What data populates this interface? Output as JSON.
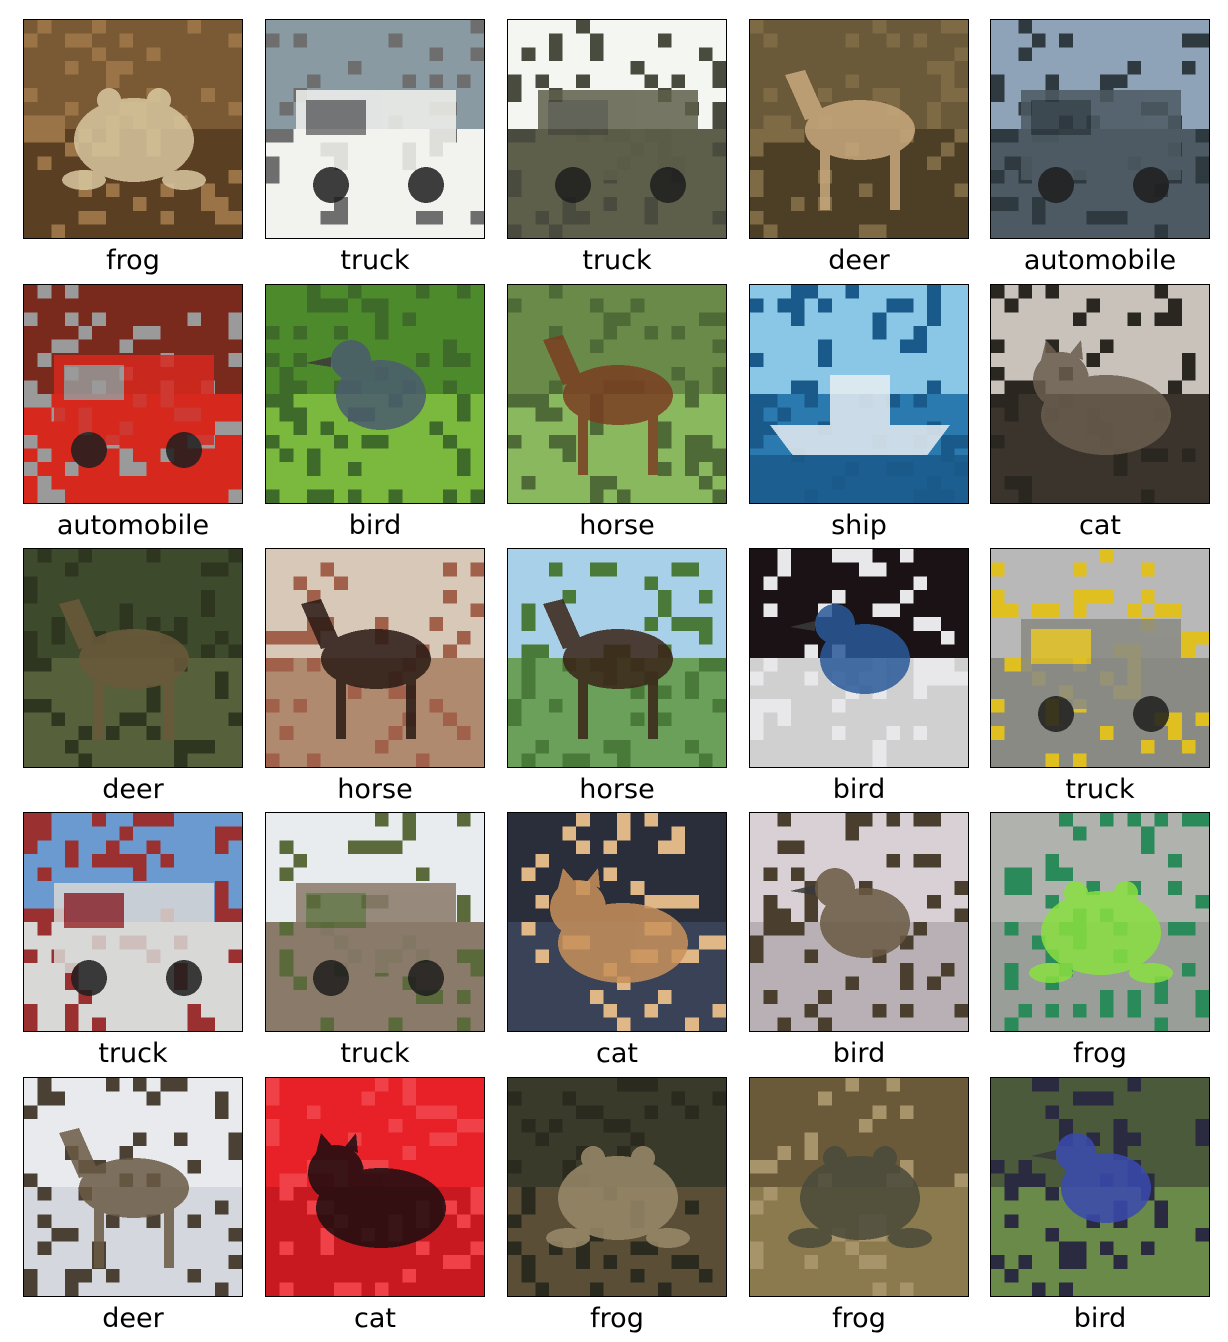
{
  "images": [
    {
      "label": "frog",
      "subject": "frog",
      "colors": [
        "#7a5a34",
        "#5a3f22",
        "#d9c8a0",
        "#9a7446"
      ]
    },
    {
      "label": "truck",
      "subject": "truck",
      "colors": [
        "#8a9aa3",
        "#f2f2ef",
        "#cbb88f",
        "#6e6e6e"
      ]
    },
    {
      "label": "truck",
      "subject": "truck",
      "colors": [
        "#f4f6f2",
        "#5e5f4a",
        "#7a3a30",
        "#4a4b3f"
      ]
    },
    {
      "label": "deer",
      "subject": "deer",
      "colors": [
        "#6b5a3a",
        "#4d3f26",
        "#c9a97e",
        "#7e6a44"
      ]
    },
    {
      "label": "automobile",
      "subject": "automobile",
      "colors": [
        "#8fa3b8",
        "#4d5a63",
        "#c9b8ad",
        "#2f3a40"
      ]
    },
    {
      "label": "automobile",
      "subject": "automobile",
      "colors": [
        "#7a2a1c",
        "#d7281e",
        "#e06a2a",
        "#9a9a9a"
      ]
    },
    {
      "label": "bird",
      "subject": "bird",
      "colors": [
        "#4d8a2c",
        "#7ab83e",
        "#4a5c6e",
        "#3e6a2a"
      ]
    },
    {
      "label": "horse",
      "subject": "horse",
      "colors": [
        "#6a8a4a",
        "#8ab85e",
        "#7a3e22",
        "#4e6a36"
      ]
    },
    {
      "label": "ship",
      "subject": "ship",
      "colors": [
        "#8ac6e6",
        "#2a7ab0",
        "#e8eef2",
        "#1a5a8a"
      ]
    },
    {
      "label": "cat",
      "subject": "cat",
      "colors": [
        "#c8c2ba",
        "#3a342c",
        "#6a5e4e",
        "#2a2620"
      ]
    },
    {
      "label": "deer",
      "subject": "deer",
      "colors": [
        "#3e4a2c",
        "#56603a",
        "#6a5a3a",
        "#2e3620"
      ]
    },
    {
      "label": "horse",
      "subject": "horse",
      "colors": [
        "#d8c8b8",
        "#b08a6e",
        "#2a1a14",
        "#a0604a"
      ]
    },
    {
      "label": "horse",
      "subject": "horse",
      "colors": [
        "#a8d0e8",
        "#6aa05a",
        "#3a2418",
        "#4a7a3a"
      ]
    },
    {
      "label": "bird",
      "subject": "bird",
      "colors": [
        "#1a1214",
        "#d0d0d0",
        "#2a5a9a",
        "#e8e8ea"
      ]
    },
    {
      "label": "truck",
      "subject": "truck",
      "colors": [
        "#b8b8b8",
        "#8a8a84",
        "#2a6a2a",
        "#e0c020"
      ]
    },
    {
      "label": "truck",
      "subject": "truck",
      "colors": [
        "#6a9ad0",
        "#d8d8d6",
        "#a0a4a2",
        "#9a3030"
      ]
    },
    {
      "label": "truck",
      "subject": "truck",
      "colors": [
        "#e8ecee",
        "#8a7a6a",
        "#4a4e52",
        "#5a6a3a"
      ]
    },
    {
      "label": "cat",
      "subject": "cat",
      "colors": [
        "#2a2e3a",
        "#3a4258",
        "#c8905a",
        "#e0b888"
      ]
    },
    {
      "label": "bird",
      "subject": "bird",
      "colors": [
        "#d8d0d4",
        "#b8b0b4",
        "#6a5a44",
        "#4a3e2e"
      ]
    },
    {
      "label": "frog",
      "subject": "frog",
      "colors": [
        "#b0b2ae",
        "#9a9e98",
        "#8ae040",
        "#2a8a5a"
      ]
    },
    {
      "label": "deer",
      "subject": "deer",
      "colors": [
        "#e8eaee",
        "#d4d8de",
        "#6a5a44",
        "#4a4034"
      ]
    },
    {
      "label": "cat",
      "subject": "cat",
      "colors": [
        "#e82028",
        "#c81820",
        "#1a0e10",
        "#f04048"
      ]
    },
    {
      "label": "frog",
      "subject": "frog",
      "colors": [
        "#3a3a2a",
        "#5a4e36",
        "#9a8a6a",
        "#2a2a1e"
      ]
    },
    {
      "label": "frog",
      "subject": "frog",
      "colors": [
        "#6a5a3a",
        "#8a7a4e",
        "#4a4a3a",
        "#a8946a"
      ]
    },
    {
      "label": "bird",
      "subject": "bird",
      "colors": [
        "#4a5a3a",
        "#6a8a4a",
        "#3a4ab0",
        "#2a2a40"
      ]
    }
  ]
}
